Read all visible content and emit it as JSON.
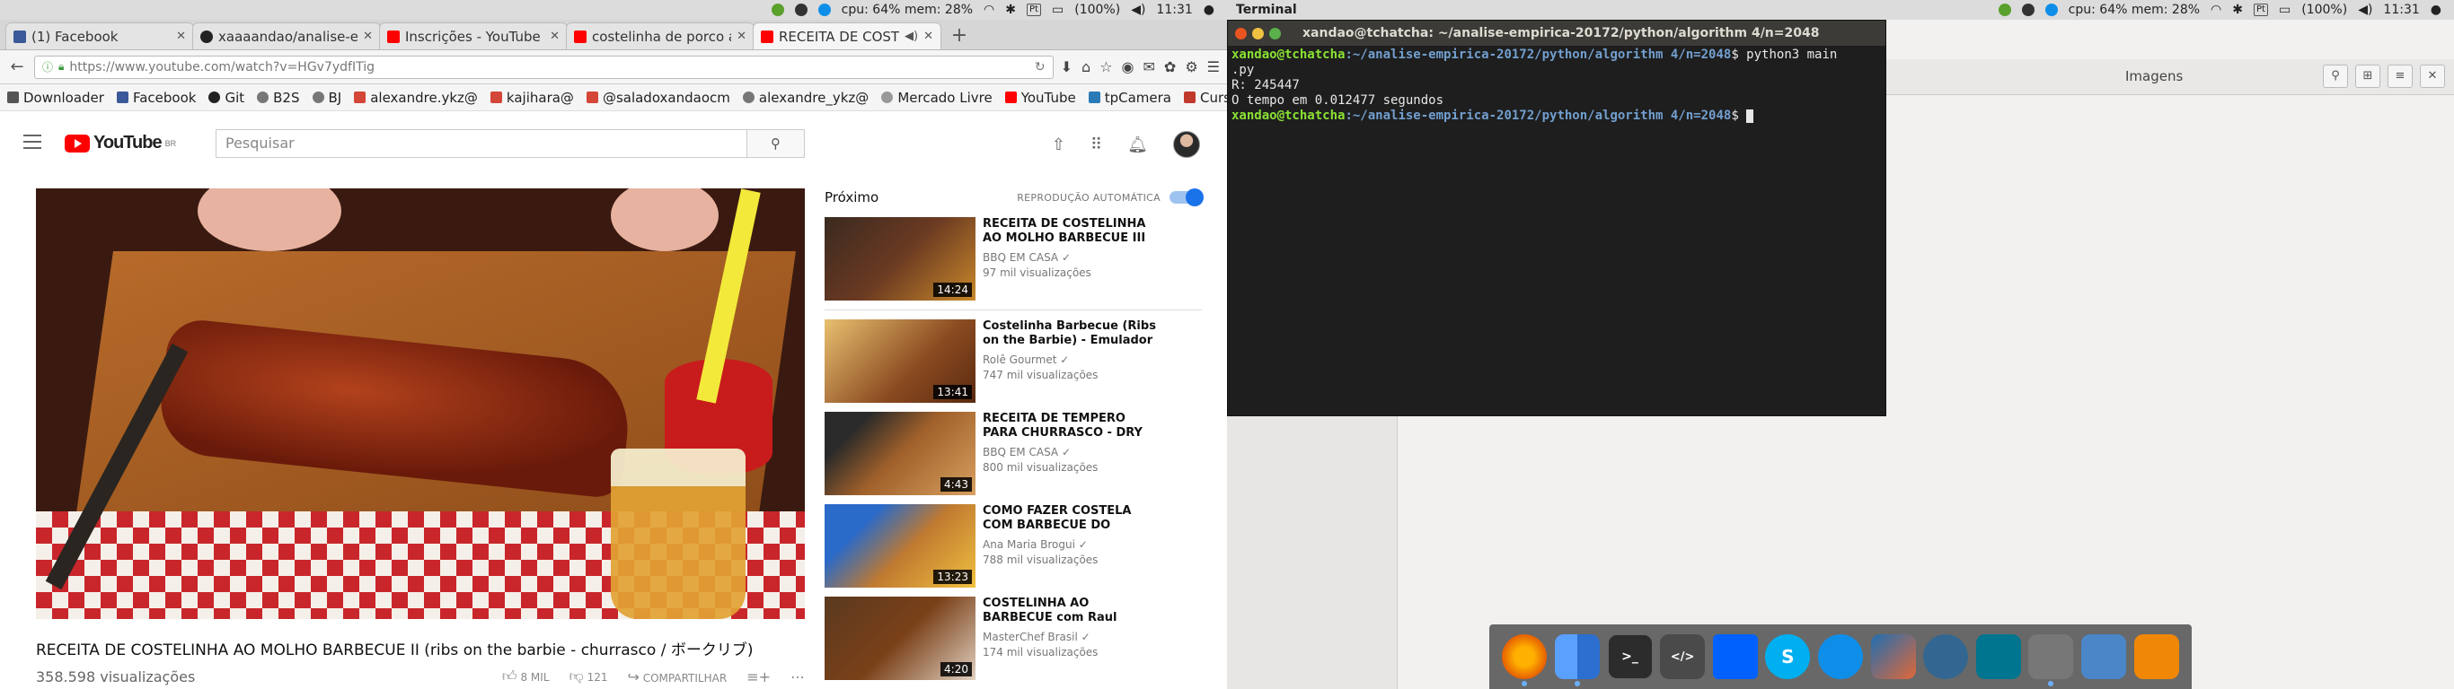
{
  "panel_left": {
    "cpu_mem": "cpu: 64% mem: 28%",
    "battery": "(100%)",
    "time": "11:31"
  },
  "panel_right": {
    "cpu_mem": "cpu: 64% mem: 28%",
    "battery": "(100%)",
    "time": "11:31",
    "app_name": "Terminal"
  },
  "browser": {
    "tabs": [
      {
        "label": "(1) Facebook",
        "color": "#3b5998"
      },
      {
        "label": "xaaaandao/analise-em",
        "color": "#222222"
      },
      {
        "label": "Inscrições - YouTube",
        "color": "#ff0000"
      },
      {
        "label": "costelinha de porco a",
        "color": "#ff0000"
      },
      {
        "label": "RECEITA DE COSTEL",
        "color": "#ff0000"
      }
    ],
    "url": "https://www.youtube.com/watch?v=HGv7ydfITig",
    "bookmarks": [
      {
        "label": "Downloader",
        "color": "#555555"
      },
      {
        "label": "Facebook",
        "color": "#3b5998"
      },
      {
        "label": "Git",
        "color": "#222222"
      },
      {
        "label": "B2S",
        "color": "#777777"
      },
      {
        "label": "BJ",
        "color": "#777777"
      },
      {
        "label": "alexandre.ykz@",
        "color": "#d44638"
      },
      {
        "label": "kajihara@",
        "color": "#d44638"
      },
      {
        "label": "@saladoxandaocm",
        "color": "#d44638"
      },
      {
        "label": "alexandre_ykz@",
        "color": "#777777"
      },
      {
        "label": "Mercado Livre",
        "color": "#999999"
      },
      {
        "label": "YouTube",
        "color": "#ff0000"
      },
      {
        "label": "tpCamera",
        "color": "#2a7ab8"
      },
      {
        "label": "Cursinho",
        "color": "#c0392b"
      }
    ]
  },
  "youtube": {
    "logo_text": "YouTube",
    "logo_region": "BR",
    "search_placeholder": "Pesquisar",
    "video_title": "RECEITA DE COSTELINHA AO MOLHO BARBECUE II (ribs on the barbie - churrasco / ボークリブ)",
    "views": "358.598 visualizações",
    "likes": "8 MIL",
    "dislikes": "121",
    "share_label": "COMPARTILHAR",
    "up_next_label": "Próximo",
    "autoplay_label": "REPRODUÇÃO AUTOMÁTICA",
    "recommendations": [
      {
        "title": "RECEITA DE COSTELINHA AO MOLHO BARBECUE III (ribs on",
        "channel": "BBQ EM CASA",
        "views": "97 mil visualizações",
        "duration": "14:24",
        "thumb_color": "#6b3a22"
      },
      {
        "title": "Costelinha Barbecue (Ribs on the Barbie) - Emulador de",
        "channel": "Rolê Gourmet",
        "views": "747 mil visualizações",
        "duration": "13:41",
        "thumb_color": "#8a4a20"
      },
      {
        "title": "RECEITA DE TEMPERO PARA CHURRASCO - DRY RUB",
        "channel": "BBQ EM CASA",
        "views": "800 mil visualizações",
        "duration": "4:43",
        "thumb_color": "#a0602a"
      },
      {
        "title": "COMO FAZER COSTELA COM BARBECUE DO APPLEBEE'S |",
        "channel": "Ana Maria Brogui",
        "views": "788 mil visualizações",
        "duration": "13:23",
        "thumb_color": "#c07a30"
      },
      {
        "title": "COSTELINHA AO BARBECUE com Raul Lemos | DICAS",
        "channel": "MasterChef Brasil",
        "views": "174 mil visualizações",
        "duration": "4:20",
        "thumb_color": "#7a4018"
      }
    ]
  },
  "terminal": {
    "title": "xandao@tchatcha: ~/analise-empirica-20172/python/algorithm 4/n=2048",
    "user_host": "xandao@tchatcha",
    "path": ":~/analise-empirica-20172/python/algorithm 4/n=2048",
    "command": "$ python3 main",
    "command_wrap": ".py",
    "output_1": "R: 245447",
    "output_2": "O tempo em 0.012477 segundos",
    "prompt_end": "$ "
  },
  "file_manager": {
    "title": "Imagens"
  },
  "dock": {
    "apps": [
      {
        "name": "firefox",
        "label": "",
        "color": "#e66000"
      },
      {
        "name": "files",
        "label": "",
        "color": "#3d7bd8"
      },
      {
        "name": "terminal",
        "label": ">_",
        "color": "#2c2c2c"
      },
      {
        "name": "editor",
        "label": "</>",
        "color": "#4a4a4a"
      },
      {
        "name": "dropbox",
        "label": "",
        "color": "#0061fe"
      },
      {
        "name": "skype",
        "label": "S",
        "color": "#00aff0"
      },
      {
        "name": "teamviewer",
        "label": "",
        "color": "#0e8ee9"
      },
      {
        "name": "matlab",
        "label": "",
        "color": "#e16737"
      },
      {
        "name": "postgres",
        "label": "",
        "color": "#336791"
      },
      {
        "name": "mysql-workbench",
        "label": "",
        "color": "#00758f"
      },
      {
        "name": "drive",
        "label": "",
        "color": "#777777"
      },
      {
        "name": "virtualbox",
        "label": "",
        "color": "#4a86c8"
      },
      {
        "name": "draw",
        "label": "",
        "color": "#f08705"
      }
    ]
  }
}
